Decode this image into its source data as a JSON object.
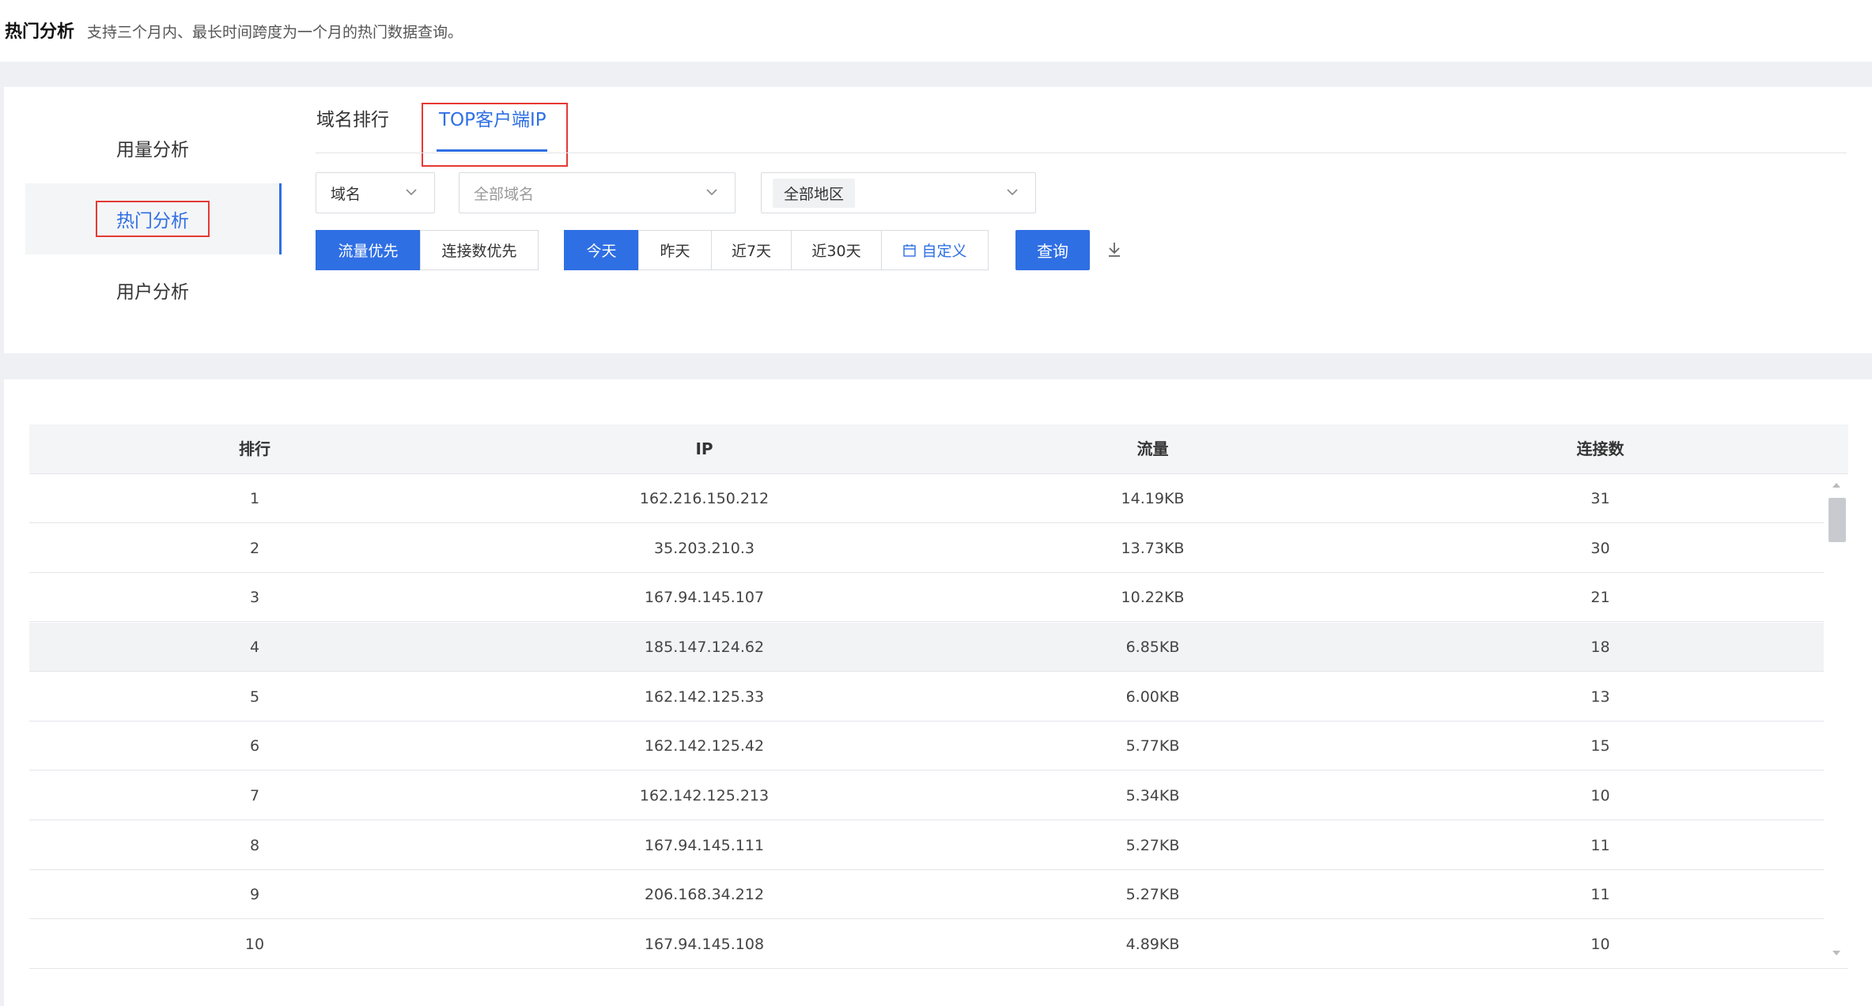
{
  "header": {
    "title": "热门分析",
    "description": "支持三个月内、最长时间跨度为一个月的热门数据查询。"
  },
  "sidebar": {
    "items": [
      {
        "label": "用量分析"
      },
      {
        "label": "热门分析",
        "active": true
      },
      {
        "label": "用户分析"
      }
    ]
  },
  "tabs": [
    {
      "label": "域名排行"
    },
    {
      "label": "TOP客户端IP",
      "active": true
    }
  ],
  "filters": {
    "type_select": "域名",
    "domain_select_placeholder": "全部域名",
    "region_select": "全部地区"
  },
  "sort_buttons": [
    {
      "label": "流量优先",
      "active": true
    },
    {
      "label": "连接数优先"
    }
  ],
  "time_buttons": [
    {
      "label": "今天",
      "active": true
    },
    {
      "label": "昨天"
    },
    {
      "label": "近7天"
    },
    {
      "label": "近30天"
    },
    {
      "label": "自定义"
    }
  ],
  "query_button": "查询",
  "table": {
    "headers": [
      "排行",
      "IP",
      "流量",
      "连接数"
    ],
    "rows": [
      [
        "1",
        "162.216.150.212",
        "14.19KB",
        "31"
      ],
      [
        "2",
        "35.203.210.3",
        "13.73KB",
        "30"
      ],
      [
        "3",
        "167.94.145.107",
        "10.22KB",
        "21"
      ],
      [
        "4",
        "185.147.124.62",
        "6.85KB",
        "18"
      ],
      [
        "5",
        "162.142.125.33",
        "6.00KB",
        "13"
      ],
      [
        "6",
        "162.142.125.42",
        "5.77KB",
        "15"
      ],
      [
        "7",
        "162.142.125.213",
        "5.34KB",
        "10"
      ],
      [
        "8",
        "167.94.145.111",
        "5.27KB",
        "11"
      ],
      [
        "9",
        "206.168.34.212",
        "5.27KB",
        "11"
      ],
      [
        "10",
        "167.94.145.108",
        "4.89KB",
        "10"
      ]
    ]
  },
  "colors": {
    "accent": "#2f6fe4",
    "highlight_box": "#e53935"
  }
}
